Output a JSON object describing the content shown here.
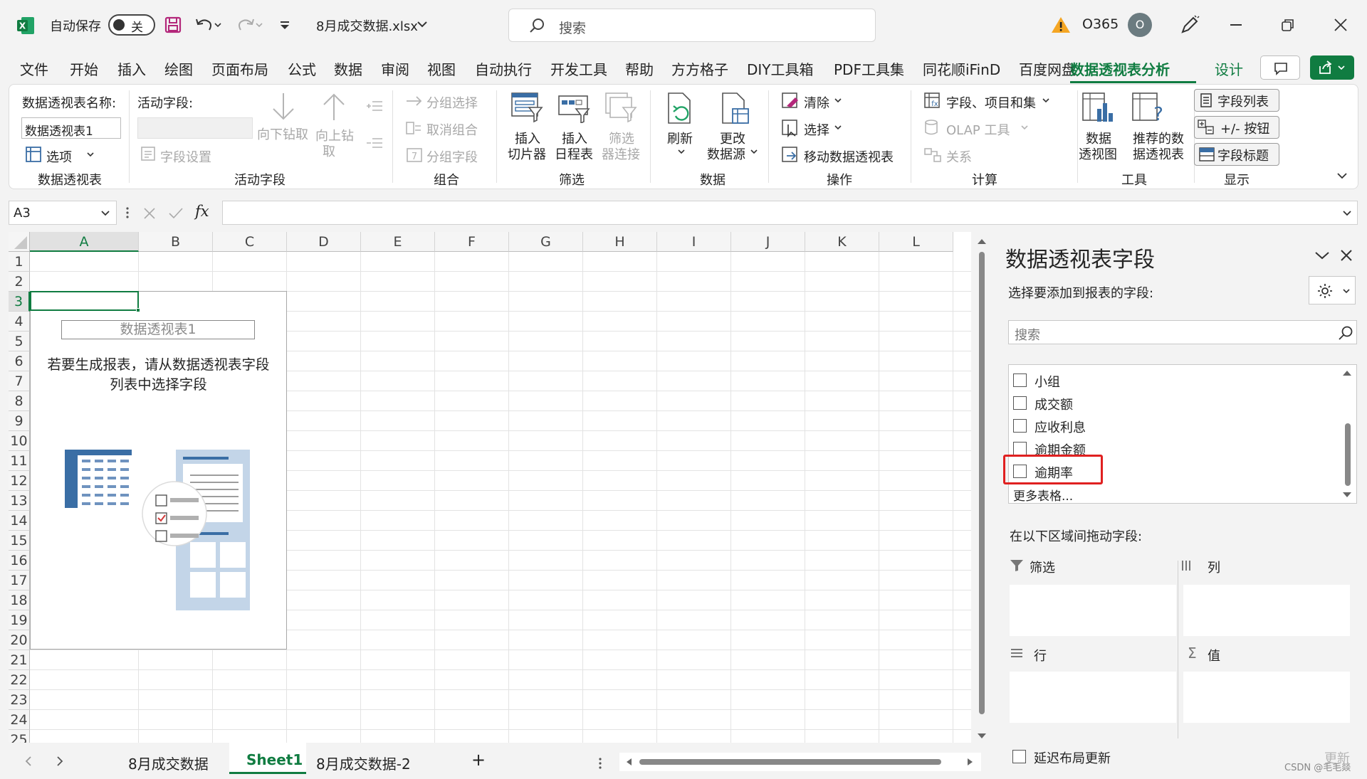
{
  "titlebar": {
    "autosave_label": "自动保存",
    "autosave_state": "关",
    "filename": "8月成交数据.xlsx",
    "search_placeholder": "搜索",
    "account": "O365",
    "avatar_letter": "O"
  },
  "menu": {
    "tabs": [
      "文件",
      "开始",
      "插入",
      "绘图",
      "页面布局",
      "公式",
      "数据",
      "审阅",
      "视图",
      "自动执行",
      "开发工具",
      "帮助",
      "方方格子",
      "DIY工具箱",
      "PDF工具集",
      "同花顺iFinD",
      "百度网盘",
      "数据透视表分析",
      "设计"
    ],
    "active_tab": "数据透视表分析"
  },
  "ribbon": {
    "pivot_name_label": "数据透视表名称:",
    "pivot_name_value": "数据透视表1",
    "options": "选项",
    "group_pivot": "数据透视表",
    "active_field_label": "活动字段:",
    "field_settings": "字段设置",
    "drill_down": "向下钻取",
    "drill_up_1": "向上钻",
    "drill_up_2": "取",
    "group_active_field": "活动字段",
    "group_selection": "分组选择",
    "ungroup": "取消组合",
    "group_field": "分组字段",
    "group_group": "组合",
    "insert_slicer_1": "插入",
    "insert_slicer_2": "切片器",
    "insert_timeline_1": "插入",
    "insert_timeline_2": "日程表",
    "filter_conn_1": "筛选",
    "filter_conn_2": "器连接",
    "group_filter": "筛选",
    "refresh": "刷新",
    "change_source_1": "更改",
    "change_source_2": "数据源",
    "group_data": "数据",
    "clear": "清除",
    "select": "选择",
    "move_pivot": "移动数据透视表",
    "group_actions": "操作",
    "fields_items_sets": "字段、项目和集",
    "olap_tools": "OLAP 工具",
    "relationships": "关系",
    "group_calc": "计算",
    "pivot_chart_1": "数据",
    "pivot_chart_2": "透视图",
    "recommended_1": "推荐的数",
    "recommended_2": "据透视表",
    "group_tools": "工具",
    "field_list": "字段列表",
    "buttons": "+/- 按钮",
    "field_headers": "字段标题",
    "group_show": "显示"
  },
  "formula": {
    "cell_ref": "A3",
    "fx": "fx",
    "content": ""
  },
  "grid": {
    "columns": [
      "A",
      "B",
      "C",
      "D",
      "E",
      "F",
      "G",
      "H",
      "I",
      "J",
      "K",
      "L"
    ],
    "rows": [
      "1",
      "2",
      "3",
      "4",
      "5",
      "6",
      "7",
      "8",
      "9",
      "10",
      "11",
      "12",
      "13",
      "14",
      "15",
      "16",
      "17",
      "18",
      "19",
      "20",
      "21",
      "22",
      "23",
      "24",
      "25"
    ],
    "selected_cell": "A3",
    "pivot_title": "数据透视表1",
    "pivot_hint_1": "若要生成报表，请从数据透视表字段",
    "pivot_hint_2": "列表中选择字段"
  },
  "sheets": {
    "tabs": [
      "8月成交数据",
      "Sheet1",
      "8月成交数据-2"
    ],
    "active": "Sheet1",
    "add": "+"
  },
  "pane": {
    "title": "数据透视表字段",
    "choose_label": "选择要添加到报表的字段:",
    "search_placeholder": "搜索",
    "fields": [
      "小组",
      "成交额",
      "应收利息",
      "逾期金额",
      "逾期率"
    ],
    "highlighted_field": "逾期率",
    "more_tables": "更多表格...",
    "drag_label": "在以下区域间拖动字段:",
    "area_filter": "筛选",
    "area_columns": "列",
    "area_rows": "行",
    "area_values": "值",
    "defer_update": "延迟布局更新",
    "update_button": "更新",
    "watermark": "CSDN @毛毛燚"
  },
  "colors": {
    "accent_green": "#107c41",
    "highlight_red": "#e02020",
    "warning": "#f5a623"
  }
}
